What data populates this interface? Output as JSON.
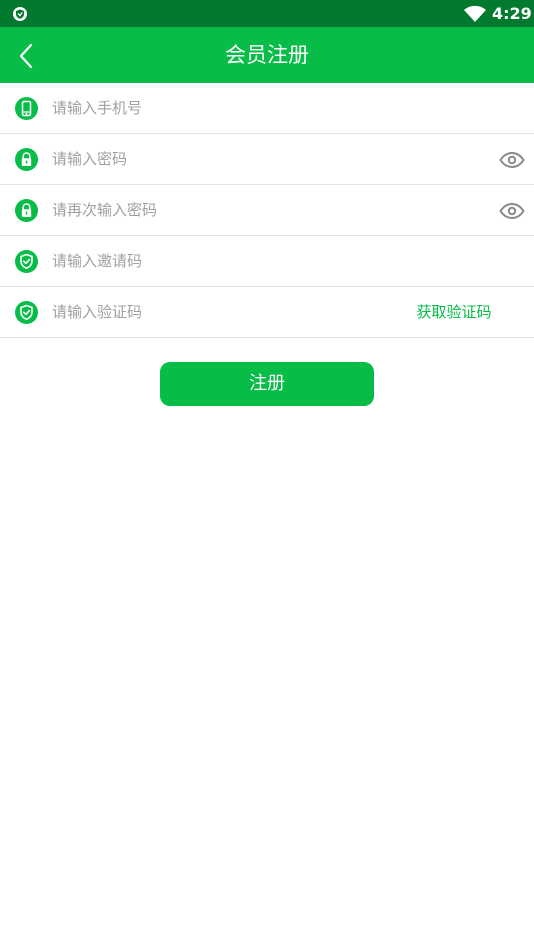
{
  "status_bar": {
    "time": "4:29",
    "left_icon": "shield-icon",
    "right_icon": "wifi-icon"
  },
  "header": {
    "title": "会员注册",
    "back_icon": "chevron-left-icon"
  },
  "form": {
    "phone": {
      "placeholder": "请输入手机号",
      "value": "",
      "icon": "phone-icon"
    },
    "password": {
      "placeholder": "请输入密码",
      "value": "",
      "icon": "lock-icon",
      "toggle_icon": "eye-icon"
    },
    "confirm_password": {
      "placeholder": "请再次输入密码",
      "value": "",
      "icon": "lock-icon",
      "toggle_icon": "eye-icon"
    },
    "invite_code": {
      "placeholder": "请输入邀请码",
      "value": "",
      "icon": "shield-check-icon"
    },
    "verify_code": {
      "placeholder": "请输入验证码",
      "value": "",
      "icon": "shield-check-icon",
      "get_code_label": "获取验证码"
    }
  },
  "register_label": "注册",
  "colors": {
    "status_bar": "#017a2e",
    "primary": "#07bd47",
    "placeholder": "#a0a0a0",
    "divider": "#e3e3e3",
    "eye_icon": "#8a8a8a"
  }
}
